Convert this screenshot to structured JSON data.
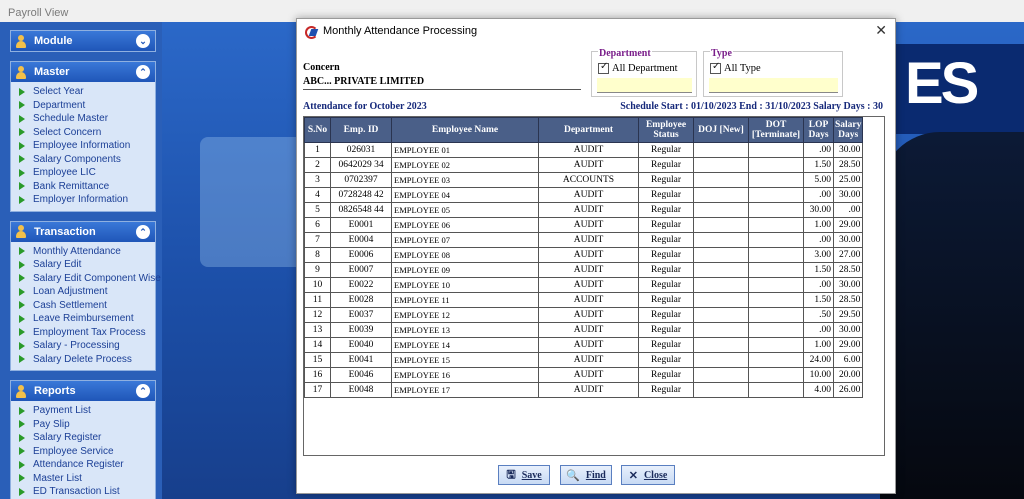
{
  "window": {
    "title": "Payroll View"
  },
  "sidebar": {
    "module": {
      "title": "Module"
    },
    "master": {
      "title": "Master",
      "items": [
        "Select Year",
        "Department",
        "Schedule Master",
        "Select Concern",
        "Employee Information",
        "Salary Components",
        "Employee LIC",
        "Bank Remittance",
        "Employer Information"
      ]
    },
    "transaction": {
      "title": "Transaction",
      "items": [
        "Monthly Attendance",
        "Salary Edit",
        "Salary Edit Component Wise",
        "Loan Adjustment",
        "Cash Settlement",
        "Leave Reimbursement",
        "Employment Tax Process",
        "Salary - Processing",
        "Salary Delete Process"
      ]
    },
    "reports": {
      "title": "Reports",
      "items": [
        "Payment List",
        "Pay Slip",
        "Salary Register",
        "Employee Service",
        "Attendance Register",
        "Master List",
        "ED Transaction List"
      ]
    }
  },
  "dialog": {
    "title": "Monthly Attendance Processing",
    "concern_label": "Concern",
    "concern_value": "ABC... PRIVATE LIMITED",
    "department": {
      "title": "Department",
      "checkbox_label": "All Department",
      "checked": true
    },
    "type": {
      "title": "Type",
      "checkbox_label": "All Type",
      "checked": true
    },
    "attendance_label": "Attendance for October 2023",
    "schedule_label": "Schedule Start : 01/10/2023 End : 31/10/2023 Salary Days : 30",
    "columns": [
      {
        "key": "sno",
        "label": "S.No"
      },
      {
        "key": "emp_id",
        "label": "Emp. ID"
      },
      {
        "key": "name",
        "label": "Employee Name"
      },
      {
        "key": "dept",
        "label": "Department"
      },
      {
        "key": "status",
        "label": "Employee Status"
      },
      {
        "key": "doj",
        "label": "DOJ [New]"
      },
      {
        "key": "dot",
        "label": "DOT [Terminate]"
      },
      {
        "key": "lop",
        "label": "LOP Days"
      },
      {
        "key": "salary_days",
        "label": "Salary Days"
      }
    ],
    "rows": [
      {
        "sno": "1",
        "emp_id": "026031",
        "name": "EMPLOYEE 01",
        "dept": "AUDIT",
        "status": "Regular",
        "doj": "",
        "dot": "",
        "lop": ".00",
        "salary_days": "30.00"
      },
      {
        "sno": "2",
        "emp_id": "0642029 34",
        "name": "EMPLOYEE 02",
        "dept": "AUDIT",
        "status": "Regular",
        "doj": "",
        "dot": "",
        "lop": "1.50",
        "salary_days": "28.50"
      },
      {
        "sno": "3",
        "emp_id": "0702397",
        "name": "EMPLOYEE 03",
        "dept": "ACCOUNTS",
        "status": "Regular",
        "doj": "",
        "dot": "",
        "lop": "5.00",
        "salary_days": "25.00"
      },
      {
        "sno": "4",
        "emp_id": "0728248 42",
        "name": "EMPLOYEE 04",
        "dept": "AUDIT",
        "status": "Regular",
        "doj": "",
        "dot": "",
        "lop": ".00",
        "salary_days": "30.00"
      },
      {
        "sno": "5",
        "emp_id": "0826548 44",
        "name": "EMPLOYEE 05",
        "dept": "AUDIT",
        "status": "Regular",
        "doj": "",
        "dot": "",
        "lop": "30.00",
        "salary_days": ".00"
      },
      {
        "sno": "6",
        "emp_id": "E0001",
        "name": "EMPLOYEE 06",
        "dept": "AUDIT",
        "status": "Regular",
        "doj": "",
        "dot": "",
        "lop": "1.00",
        "salary_days": "29.00"
      },
      {
        "sno": "7",
        "emp_id": "E0004",
        "name": "EMPLOYEE 07",
        "dept": "AUDIT",
        "status": "Regular",
        "doj": "",
        "dot": "",
        "lop": ".00",
        "salary_days": "30.00"
      },
      {
        "sno": "8",
        "emp_id": "E0006",
        "name": "EMPLOYEE 08",
        "dept": "AUDIT",
        "status": "Regular",
        "doj": "",
        "dot": "",
        "lop": "3.00",
        "salary_days": "27.00"
      },
      {
        "sno": "9",
        "emp_id": "E0007",
        "name": "EMPLOYEE 09",
        "dept": "AUDIT",
        "status": "Regular",
        "doj": "",
        "dot": "",
        "lop": "1.50",
        "salary_days": "28.50"
      },
      {
        "sno": "10",
        "emp_id": "E0022",
        "name": "EMPLOYEE 10",
        "dept": "AUDIT",
        "status": "Regular",
        "doj": "",
        "dot": "",
        "lop": ".00",
        "salary_days": "30.00"
      },
      {
        "sno": "11",
        "emp_id": "E0028",
        "name": "EMPLOYEE 11",
        "dept": "AUDIT",
        "status": "Regular",
        "doj": "",
        "dot": "",
        "lop": "1.50",
        "salary_days": "28.50"
      },
      {
        "sno": "12",
        "emp_id": "E0037",
        "name": "EMPLOYEE 12",
        "dept": "AUDIT",
        "status": "Regular",
        "doj": "",
        "dot": "",
        "lop": ".50",
        "salary_days": "29.50"
      },
      {
        "sno": "13",
        "emp_id": "E0039",
        "name": "EMPLOYEE 13",
        "dept": "AUDIT",
        "status": "Regular",
        "doj": "",
        "dot": "",
        "lop": ".00",
        "salary_days": "30.00"
      },
      {
        "sno": "14",
        "emp_id": "E0040",
        "name": "EMPLOYEE 14",
        "dept": "AUDIT",
        "status": "Regular",
        "doj": "",
        "dot": "",
        "lop": "1.00",
        "salary_days": "29.00"
      },
      {
        "sno": "15",
        "emp_id": "E0041",
        "name": "EMPLOYEE 15",
        "dept": "AUDIT",
        "status": "Regular",
        "doj": "",
        "dot": "",
        "lop": "24.00",
        "salary_days": "6.00"
      },
      {
        "sno": "16",
        "emp_id": "E0046",
        "name": "EMPLOYEE 16",
        "dept": "AUDIT",
        "status": "Regular",
        "doj": "",
        "dot": "",
        "lop": "10.00",
        "salary_days": "20.00"
      },
      {
        "sno": "17",
        "emp_id": "E0048",
        "name": "EMPLOYEE 17",
        "dept": "AUDIT",
        "status": "Regular",
        "doj": "",
        "dot": "",
        "lop": "4.00",
        "salary_days": "26.00"
      }
    ],
    "buttons": {
      "save": "Save",
      "find": "Find",
      "close": "Close"
    }
  },
  "desktop": {
    "logo_text": "ES"
  },
  "colors": {
    "sidebar_bg": "#2a5fb8",
    "panel_header": "#1f56b8",
    "grid_header": "#4a5f88",
    "heading_text": "#15287a",
    "filter_title": "#7a1e8a",
    "field_bg": "#ffffcc"
  }
}
